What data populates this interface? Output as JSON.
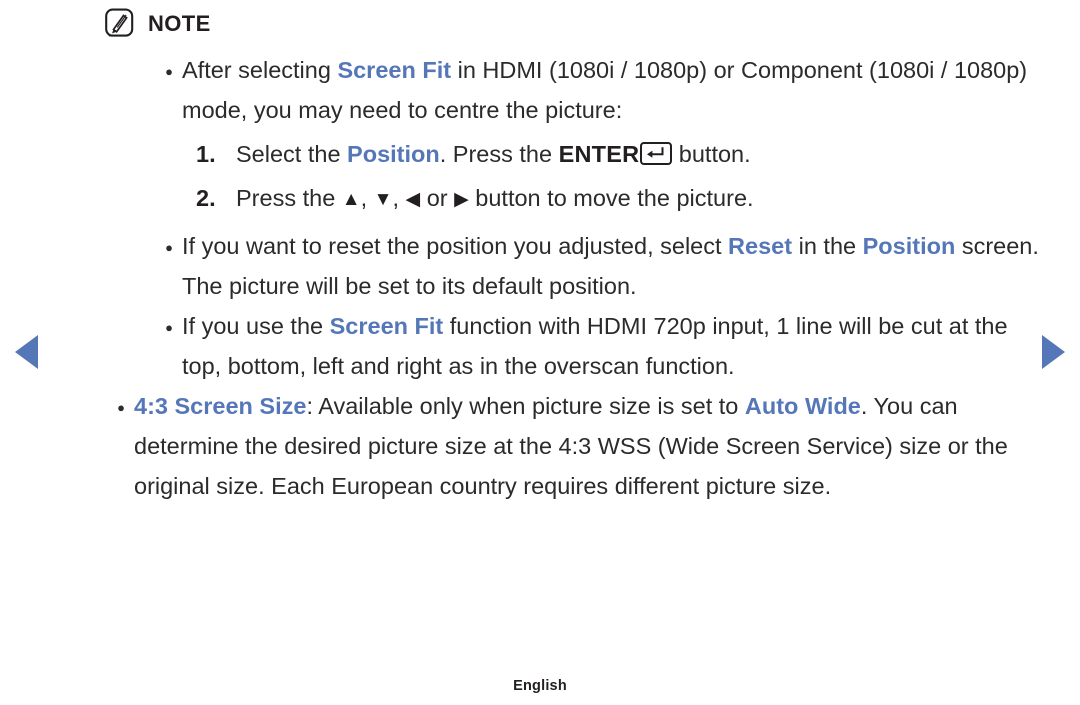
{
  "accent_color": "#5577b8",
  "text_color": "#2b2b2b",
  "note": {
    "icon": "note-pencil-icon",
    "title": "NOTE"
  },
  "bullets": [
    {
      "id": "bullet-screen-fit-centre",
      "level": 1,
      "segments": [
        {
          "text": "After selecting ",
          "style": "normal"
        },
        {
          "text": "Screen Fit",
          "style": "highlight"
        },
        {
          "text": " in HDMI (1080i / 1080p) or Component (1080i / 1080p) mode, you may need to centre the picture:",
          "style": "normal"
        }
      ],
      "steps": [
        {
          "number": "1.",
          "segments": [
            {
              "text": "Select the ",
              "style": "normal"
            },
            {
              "text": "Position",
              "style": "highlight"
            },
            {
              "text": ". Press the ",
              "style": "normal"
            },
            {
              "text": "ENTER",
              "style": "strong"
            },
            {
              "text": "enter-key-icon",
              "style": "key-enter"
            },
            {
              "text": " button.",
              "style": "normal"
            }
          ]
        },
        {
          "number": "2.",
          "segments": [
            {
              "text": "Press the ",
              "style": "normal"
            },
            {
              "text": "▲",
              "style": "triangle-up"
            },
            {
              "text": ", ",
              "style": "normal"
            },
            {
              "text": "▼",
              "style": "triangle-down"
            },
            {
              "text": ", ",
              "style": "normal"
            },
            {
              "text": "◀",
              "style": "triangle-left"
            },
            {
              "text": " or ",
              "style": "normal"
            },
            {
              "text": "▶",
              "style": "triangle-right"
            },
            {
              "text": " button to move the picture.",
              "style": "normal"
            }
          ]
        }
      ]
    },
    {
      "id": "bullet-reset-position",
      "level": 1,
      "segments": [
        {
          "text": "If you want to reset the position you adjusted, select ",
          "style": "normal"
        },
        {
          "text": "Reset",
          "style": "highlight"
        },
        {
          "text": " in the ",
          "style": "normal"
        },
        {
          "text": "Position",
          "style": "highlight"
        },
        {
          "text": " screen. The picture will be set to its default position.",
          "style": "normal"
        }
      ]
    },
    {
      "id": "bullet-screen-fit-720p",
      "level": 1,
      "segments": [
        {
          "text": "If you use the ",
          "style": "normal"
        },
        {
          "text": "Screen Fit",
          "style": "highlight"
        },
        {
          "text": " function with HDMI 720p input, 1 line will be cut at the top, bottom, left and right as in the overscan function.",
          "style": "normal"
        }
      ]
    },
    {
      "id": "bullet-4-3-screen-size",
      "level": 0,
      "segments": [
        {
          "text": "4:3 Screen Size",
          "style": "highlight"
        },
        {
          "text": ": Available only when picture size is set to ",
          "style": "normal"
        },
        {
          "text": "Auto Wide",
          "style": "highlight"
        },
        {
          "text": ". You can determine the desired picture size at the 4:3 WSS (Wide Screen Service) size or the original size. Each European country requires different picture size.",
          "style": "normal"
        }
      ]
    }
  ],
  "nav": {
    "prev_label": "previous-page-arrow",
    "next_label": "next-page-arrow",
    "arrow_color": "#5577b8"
  },
  "footer": {
    "language": "English"
  }
}
